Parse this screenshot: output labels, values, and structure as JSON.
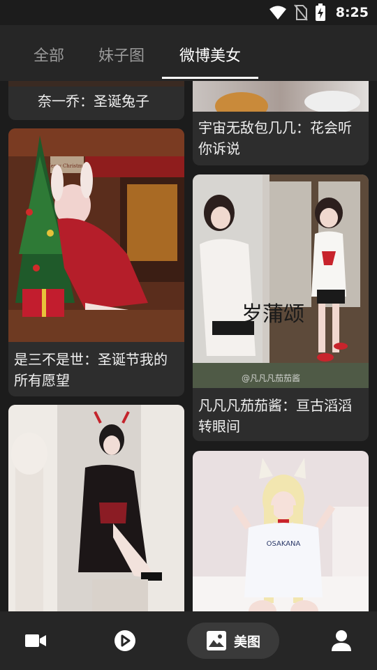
{
  "status_bar": {
    "time": "8:25"
  },
  "tabs": [
    {
      "label": "全部"
    },
    {
      "label": "妹子图"
    },
    {
      "label": "微博美女"
    }
  ],
  "feed": {
    "cards": [
      {
        "caption": "奈一乔：圣诞兔子"
      },
      {
        "caption": "宇宙无敌包几几：花会听你诉说"
      },
      {
        "caption": "是三不是世：圣诞节我的所有愿望",
        "sign_text": "Merry Christmas"
      },
      {
        "caption": "凡凡凡茄茄酱：亘古滔滔转眼间",
        "calligraphy": "岁蒲颂",
        "watermark": "@凡凡凡茄茄酱"
      },
      {
        "caption": ""
      },
      {
        "caption": "",
        "shirt_text": "OSAKANA"
      }
    ]
  },
  "bottom_nav": {
    "items": [
      {
        "icon": "video-camera-icon"
      },
      {
        "icon": "play-circle-icon"
      },
      {
        "icon": "image-icon",
        "label": "美图"
      },
      {
        "icon": "profile-icon"
      }
    ]
  },
  "colors": {
    "background": "#1c1c1c",
    "bar": "#262626",
    "card": "#2d2d2d",
    "nav_active": "#3a3a3a"
  }
}
